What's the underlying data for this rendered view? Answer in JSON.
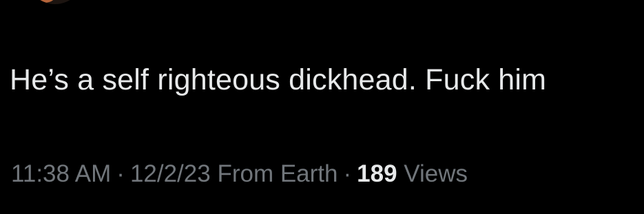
{
  "tweet": {
    "text": "He’s a self righteous dickhead.  Fuck him",
    "time": "11:38 AM",
    "separator": "·",
    "date": "12/2/23",
    "source": "From Earth",
    "views_count": "189",
    "views_label": "Views"
  },
  "colors": {
    "background": "#000000",
    "primary_text": "#e7e9ea",
    "secondary_text": "#71767b",
    "avatar_accent": "#b5643a"
  }
}
